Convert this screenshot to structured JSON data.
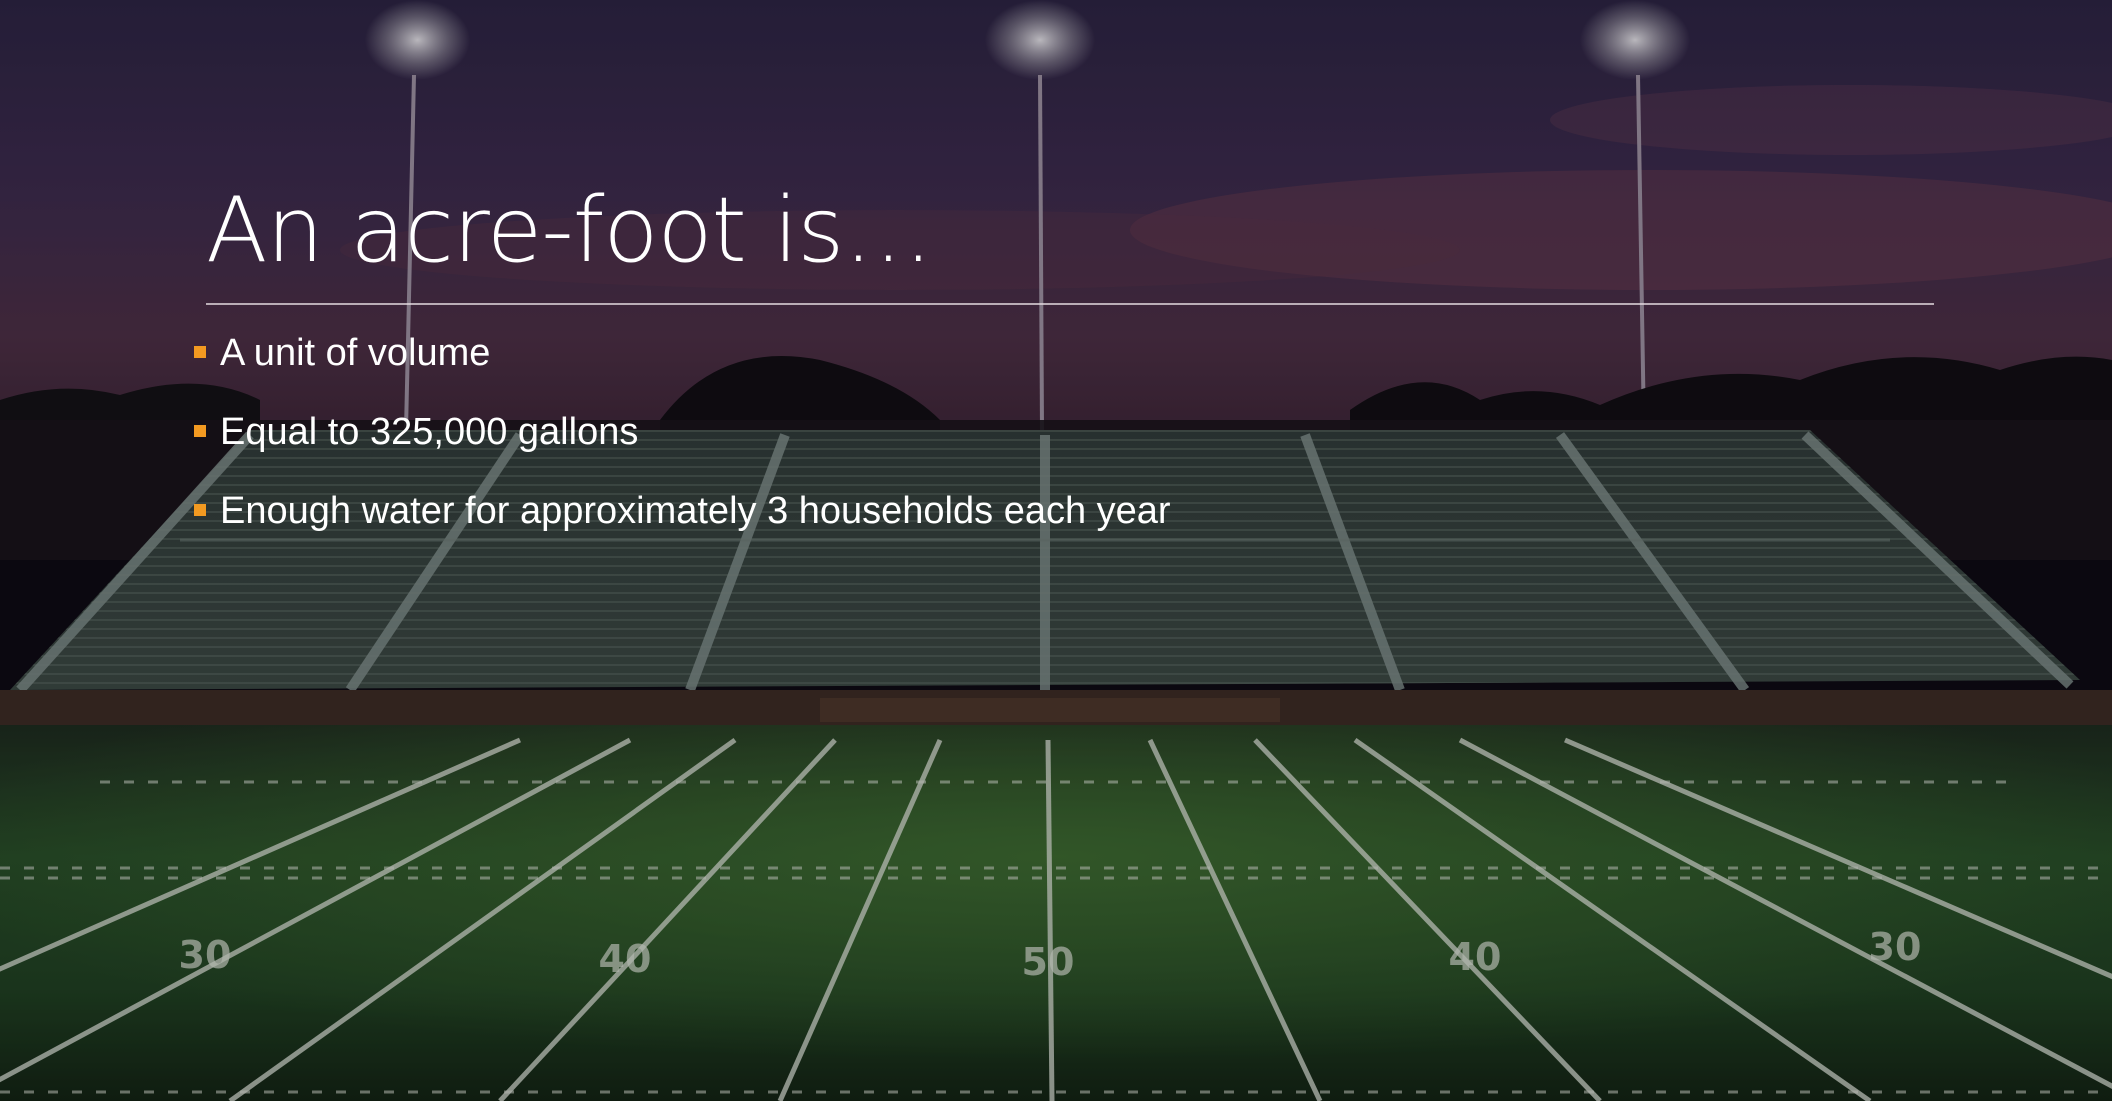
{
  "slide": {
    "title": "An acre-foot is…",
    "bullets": [
      "A unit of volume",
      "Equal to 325,000 gallons",
      "Enough water for approximately 3 households each year"
    ],
    "field_numbers": [
      "30",
      "40",
      "50",
      "40",
      "30"
    ],
    "colors": {
      "title_text": "#ffffff",
      "bullet_text": "#ffffff",
      "bullet_marker": "#f39a21",
      "rule": "#e6dce1"
    }
  }
}
